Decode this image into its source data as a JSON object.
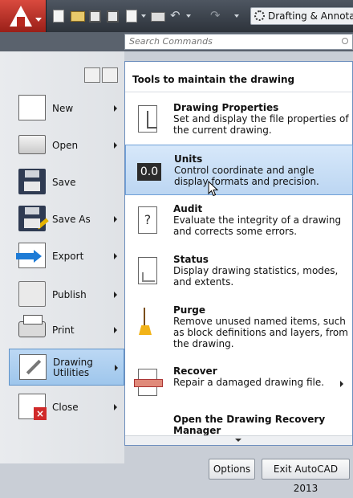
{
  "titlebar": {
    "workspace_label": "Drafting & Annotation"
  },
  "search": {
    "placeholder": "Search Commands"
  },
  "left_menu": {
    "items": [
      {
        "label": "New",
        "has_submenu": true
      },
      {
        "label": "Open",
        "has_submenu": true
      },
      {
        "label": "Save",
        "has_submenu": false
      },
      {
        "label": "Save As",
        "has_submenu": true
      },
      {
        "label": "Export",
        "has_submenu": true
      },
      {
        "label": "Publish",
        "has_submenu": true
      },
      {
        "label": "Print",
        "has_submenu": true
      },
      {
        "label": "Drawing\nUtilities",
        "has_submenu": true,
        "selected": true
      },
      {
        "label": "Close",
        "has_submenu": true
      }
    ]
  },
  "panel": {
    "heading": "Tools to maintain the drawing",
    "entries": [
      {
        "title": "Drawing Properties",
        "description": "Set and display the file properties of the current drawing."
      },
      {
        "title": "Units",
        "description": "Control coordinate and angle display formats and precision.",
        "highlighted": true,
        "icon_text": "0.0"
      },
      {
        "title": "Audit",
        "description": "Evaluate the integrity of a drawing and corrects some errors.",
        "icon_text": "?"
      },
      {
        "title": "Status",
        "description": "Display drawing statistics, modes, and extents."
      },
      {
        "title": "Purge",
        "description": "Remove unused named items, such as block definitions and layers, from the drawing."
      },
      {
        "title": "Recover",
        "description": "Repair a damaged drawing file.",
        "has_submenu": true
      },
      {
        "title": "Open the Drawing Recovery Manager",
        "description": ""
      }
    ]
  },
  "footer": {
    "options_label": "Options",
    "exit_label": "Exit AutoCAD 2013"
  }
}
